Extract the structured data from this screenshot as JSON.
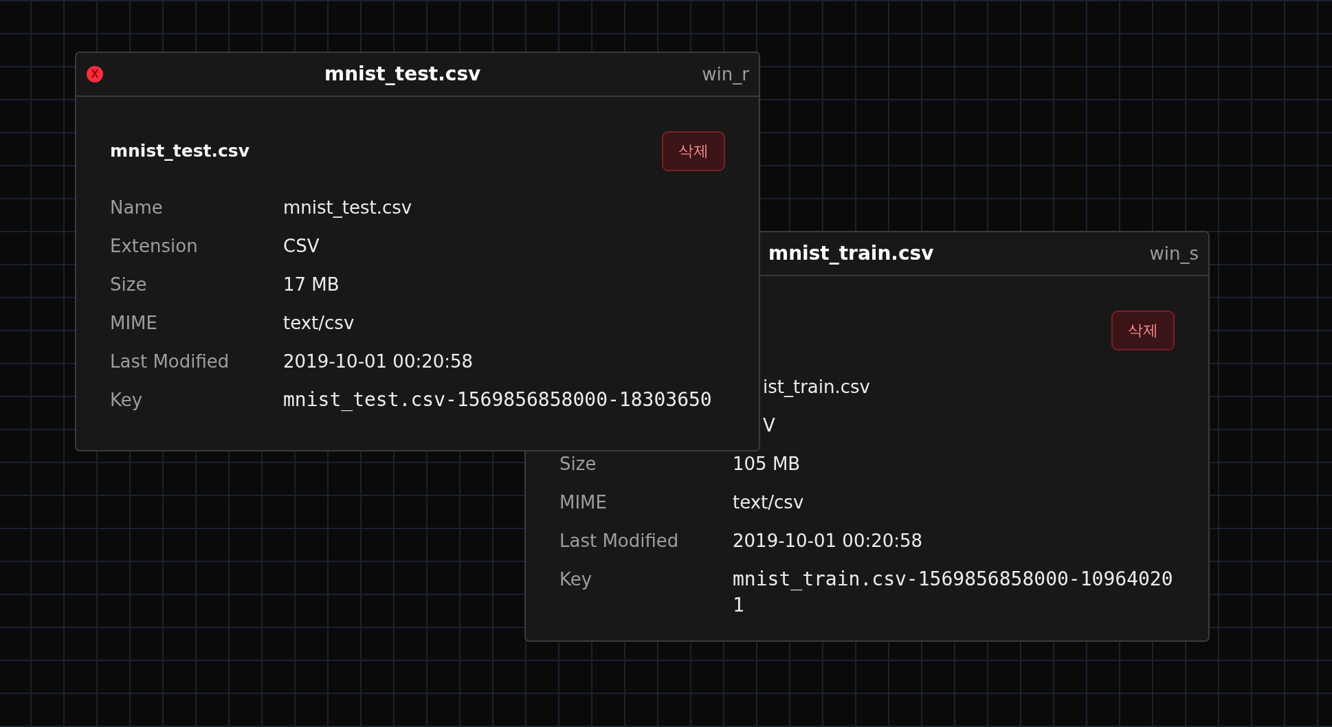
{
  "windows": [
    {
      "title": "mnist_test.csv",
      "id_label": "win_r",
      "close_button": "X",
      "heading": "mnist_test.csv",
      "delete_button": "삭제",
      "fields": [
        {
          "kind": "text",
          "label": "Name",
          "value": "mnist_test.csv"
        },
        {
          "kind": "text",
          "label": "Extension",
          "value": "CSV"
        },
        {
          "kind": "text",
          "label": "Size",
          "value": "17 MB"
        },
        {
          "kind": "text",
          "label": "MIME",
          "value": "text/csv"
        },
        {
          "kind": "text",
          "label": "Last Modified",
          "value": "2019-10-01 00:20:58"
        },
        {
          "kind": "code",
          "label": "Key",
          "value": "mnist_test.csv-1569856858000-18303650"
        }
      ]
    },
    {
      "title": "mnist_train.csv",
      "id_label": "win_s",
      "delete_button": "삭제",
      "fields": [
        {
          "kind": "text",
          "value": "ist_train.csv"
        },
        {
          "kind": "text",
          "value": "V"
        },
        {
          "kind": "text",
          "label": "Size",
          "value": "105 MB"
        },
        {
          "kind": "text",
          "label": "MIME",
          "value": "text/csv"
        },
        {
          "kind": "text",
          "label": "Last Modified",
          "value": "2019-10-01 00:20:58"
        },
        {
          "kind": "code",
          "label": "Key",
          "value": "mnist_train.csv-1569856858000-109640201"
        }
      ]
    }
  ]
}
